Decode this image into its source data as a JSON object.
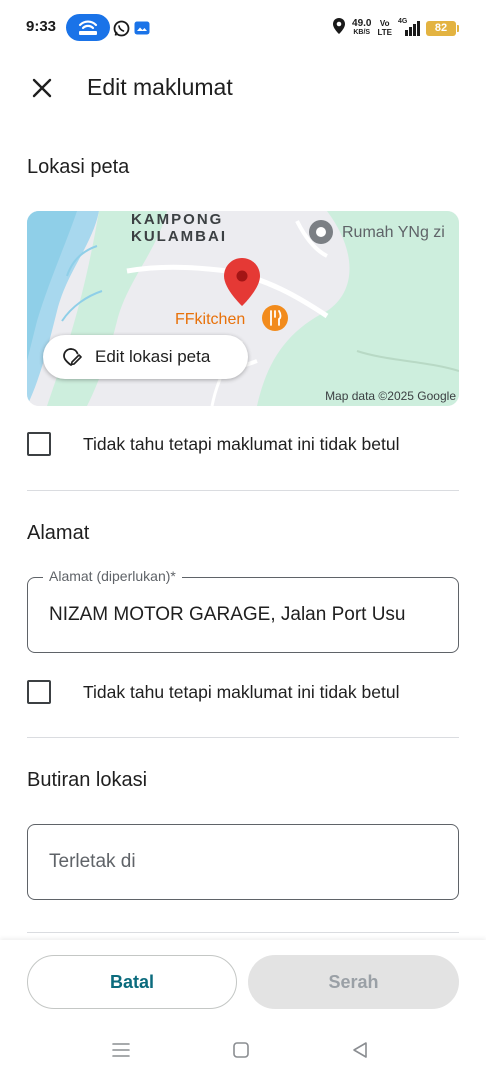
{
  "status_bar": {
    "time": "9:33",
    "net_speed_value": "49.0",
    "net_speed_unit": "KB/S",
    "volte_top": "Vo",
    "volte_bottom": "LTE",
    "network_type": "4G",
    "battery": "82",
    "colors": {
      "hotspot": "#1a73e8",
      "battery": "#e3b341"
    }
  },
  "header": {
    "title": "Edit maklumat"
  },
  "map_section": {
    "title": "Lokasi peta",
    "labels": {
      "kampong_line1": "KAMPONG",
      "kampong_line2": "KULAMBAI",
      "place_rumah": "Rumah YNg zi",
      "place_ff": "FFkitchen",
      "copyright": "Map data ©2025 Google"
    },
    "edit_button": "Edit lokasi peta",
    "checkbox_label": "Tidak tahu tetapi maklumat ini tidak betul",
    "checkbox_checked": false
  },
  "address_section": {
    "title": "Alamat",
    "field_label": "Alamat (diperlukan)*",
    "field_value": "NIZAM MOTOR GARAGE, Jalan Port Usu",
    "checkbox_label": "Tidak tahu tetapi maklumat ini tidak betul",
    "checkbox_checked": false
  },
  "details_section": {
    "title": "Butiran lokasi",
    "field_placeholder": "Terletak di",
    "field_value": ""
  },
  "actions": {
    "cancel": "Batal",
    "submit": "Serah",
    "colors": {
      "cancel_text": "#0b6b7d",
      "submit_bg": "#e3e3e3",
      "submit_text": "#9aa0a6"
    }
  }
}
